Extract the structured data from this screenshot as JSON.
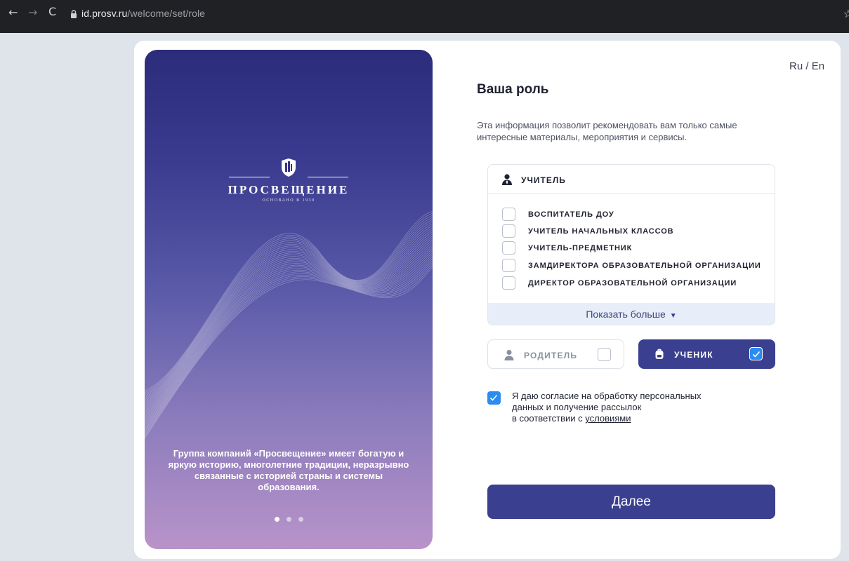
{
  "browser": {
    "back_icon": "←",
    "forward_icon": "→",
    "reload_icon": "C",
    "url_domain": "id.prosv.ru",
    "url_path": "/welcome/set/role",
    "star_icon": "☆"
  },
  "promo": {
    "brand": "ПРОСВЕЩЕНИЕ",
    "brand_sub": "ОСНОВАНО В 1930",
    "text": "Группа компаний «Просвещение» имеет богатую и яркую историю, многолетние традиции, неразрывно связанные с историей страны и системы образования.",
    "carousel_pages": 3,
    "carousel_active": 1
  },
  "lang": {
    "ru": "Ru",
    "sep": " / ",
    "en": "En"
  },
  "form": {
    "title": "Ваша роль",
    "description": "Эта информация позволит рекомендовать вам только самые интересные материалы, мероприятия и сервисы.",
    "teacher": {
      "label": "УЧИТЕЛЬ",
      "options": [
        {
          "label": "ВОСПИТАТЕЛЬ ДОУ",
          "checked": false
        },
        {
          "label": "УЧИТЕЛЬ НАЧАЛЬНЫХ КЛАССОВ",
          "checked": false
        },
        {
          "label": "УЧИТЕЛЬ-ПРЕДМЕТНИК",
          "checked": false
        },
        {
          "label": "ЗАМДИРЕКТОРА ОБРАЗОВАТЕЛЬНОЙ ОРГАНИЗАЦИИ",
          "checked": false
        },
        {
          "label": "ДИРЕКТОР ОБРАЗОВАТЕЛЬНОЙ ОРГАНИЗАЦИИ",
          "checked": false
        }
      ],
      "show_more": "Показать больше",
      "show_more_icon": "▼"
    },
    "parent": {
      "label": "РОДИТЕЛЬ",
      "checked": false
    },
    "student": {
      "label": "УЧЕНИК",
      "checked": true
    },
    "consent": {
      "checked": true,
      "line1": "Я даю согласие на обработку персональных",
      "line2": "данных и получение рассылок",
      "line3_prefix": "в соответствии с ",
      "link": "условиями"
    },
    "next_button": "Далее"
  },
  "colors": {
    "accent": "#3a3f8f",
    "checkbox_checked": "#2d8cf0",
    "promo_top": "#2c2c7c",
    "promo_bottom": "#b993c9",
    "show_more_bg": "#e7eef9"
  }
}
